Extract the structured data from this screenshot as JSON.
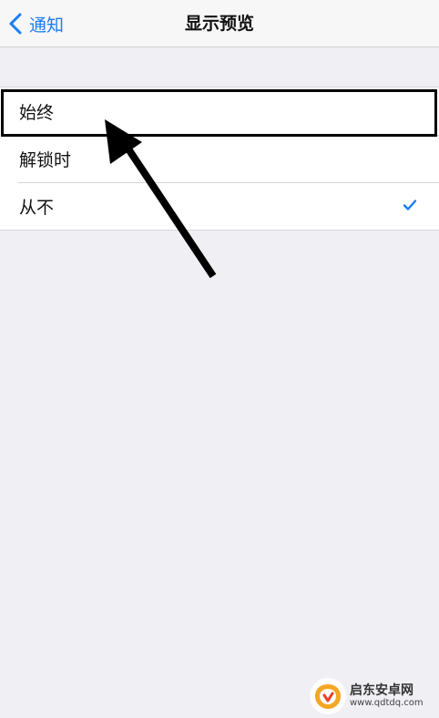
{
  "nav": {
    "back_label": "通知",
    "title": "显示预览"
  },
  "options": [
    {
      "label": "始终",
      "selected": false,
      "highlighted": true
    },
    {
      "label": "解锁时",
      "selected": false,
      "highlighted": false
    },
    {
      "label": "从不",
      "selected": true,
      "highlighted": false
    }
  ],
  "annotation": {
    "arrow": "arrow-pointing-to-first-option"
  },
  "watermark": {
    "site_name": "启东安卓网",
    "url": "www.qdtdq.com"
  },
  "colors": {
    "accent": "#1a7cf5",
    "background": "#efeff4",
    "row_bg": "#ffffff",
    "navbar_bg": "#f7f7f7",
    "annotation": "#000000",
    "watermark_accent": "#f5a623"
  }
}
